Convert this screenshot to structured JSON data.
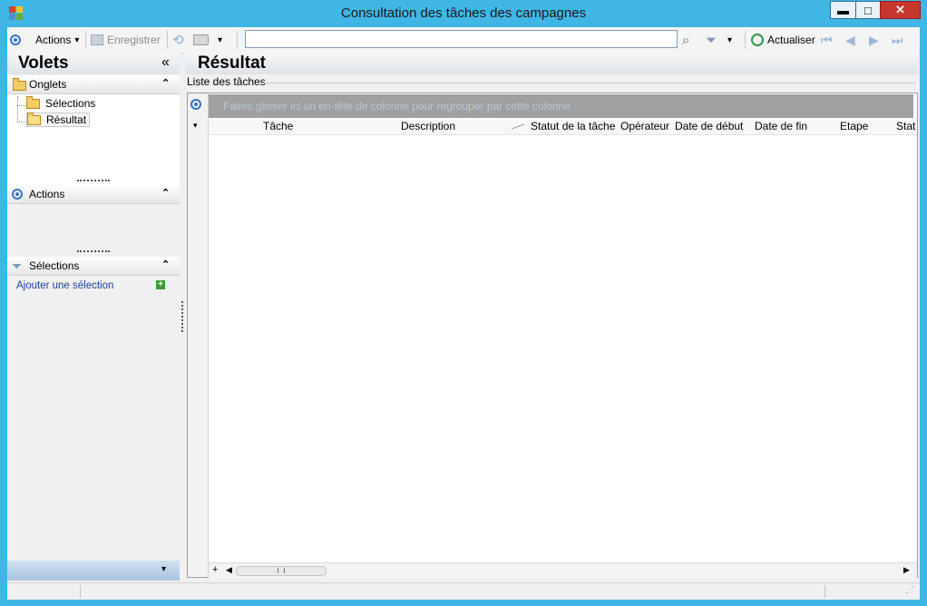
{
  "window": {
    "title": "Consultation des tâches des campagnes",
    "controls": [
      "minimize",
      "maximize",
      "close"
    ],
    "minimize_glyph": "▬",
    "maximize_glyph": "□",
    "close_glyph": "✕"
  },
  "toolbar": {
    "actions_label": "Actions",
    "save_label": "Enregistrer",
    "search_value": "",
    "refresh_label": "Actualiser",
    "dropdown_glyph": "▾",
    "nav_first_glyph": "⏮",
    "nav_prev_glyph": "◀",
    "nav_next_glyph": "▶",
    "nav_last_glyph": "⏭"
  },
  "left_panel": {
    "title": "Volets",
    "collapse_glyph": "«",
    "chevron_glyph": "⌃",
    "onglets": {
      "title": "Onglets",
      "items": [
        "Sélections",
        "Résultat"
      ],
      "selected": "Résultat"
    },
    "actions": {
      "title": "Actions"
    },
    "selections": {
      "title": "Sélections",
      "add_link": "Ajouter une sélection"
    }
  },
  "right_panel": {
    "title": "Résultat",
    "list_label": "Liste des tâches",
    "group_band_text": "Faites glisser ici un en-tête de colonne pour regrouper par cette colonne",
    "columns": [
      "Tâche",
      "Description",
      "Statut de la tâche",
      "Opérateur",
      "Date de début",
      "Date de fin",
      "Etape",
      "Stat"
    ],
    "sort_column": "Statut de la tâche",
    "add_row_glyph": "+"
  },
  "colors": {
    "titlebar": "#40b6e4",
    "close_button": "#c7372f",
    "accent_blue": "#3672c2",
    "link_blue": "#1a3fa0",
    "group_band": "#a0a0a0"
  },
  "icons": [
    "app-icon",
    "actions-ring-icon",
    "save-icon",
    "refresh-icon",
    "print-icon",
    "search-icon",
    "filter-icon",
    "actualiser-icon",
    "folder-icon",
    "filter-funnel-icon",
    "add-icon"
  ]
}
